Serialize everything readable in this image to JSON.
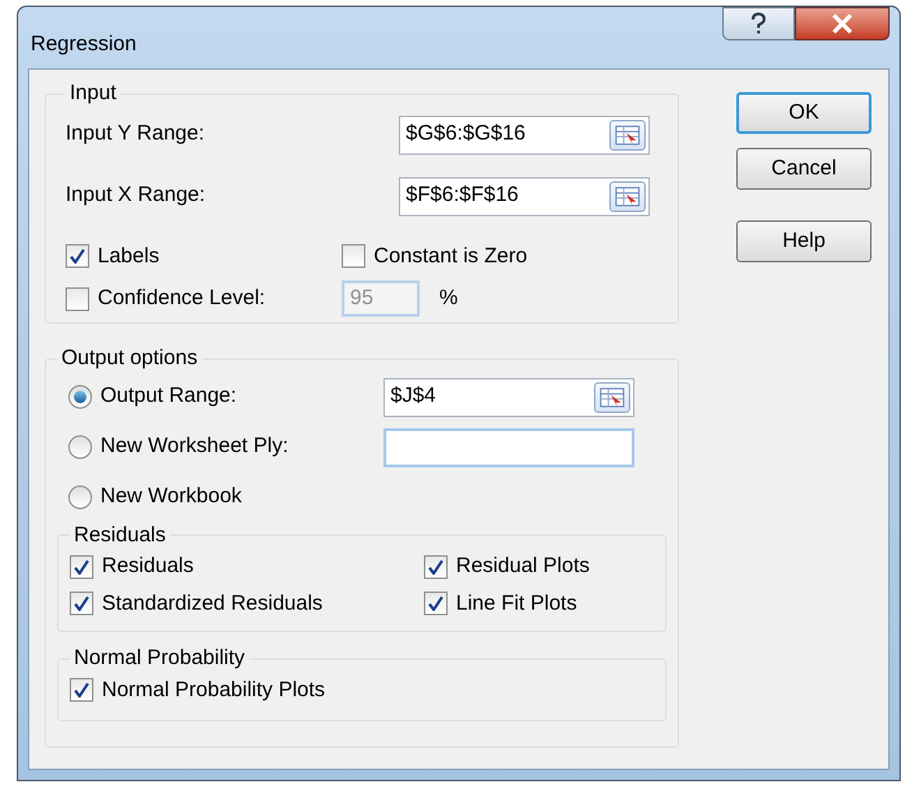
{
  "window": {
    "title": "Regression"
  },
  "input": {
    "title": "Input",
    "fields": [
      {
        "label": "Input Y Range:",
        "value": "$G$6:$G$16"
      },
      {
        "label": "Input X Range:",
        "value": "$F$6:$F$16"
      }
    ],
    "options": [
      {
        "label": "Labels",
        "checked": true
      },
      {
        "label": "Constant is Zero",
        "checked": false
      },
      {
        "label": "Confidence Level:",
        "checked": false
      }
    ],
    "confidence": {
      "value": "95",
      "unit": "%",
      "disabled": true
    }
  },
  "output": {
    "title": "Output options",
    "choices": [
      {
        "label": "Output Range:",
        "selected": true,
        "kind": "range",
        "value": "$J$4"
      },
      {
        "label": "New Worksheet Ply:",
        "selected": false,
        "kind": "text",
        "focused": true
      },
      {
        "label": "New Workbook",
        "selected": false,
        "kind": "plain"
      }
    ],
    "residuals": {
      "title": "Residuals",
      "options": [
        {
          "label": "Residuals",
          "checked": true
        },
        {
          "label": "Residual Plots",
          "checked": true
        },
        {
          "label": "Standardized Residuals",
          "checked": true
        },
        {
          "label": "Line Fit Plots",
          "checked": true
        }
      ]
    },
    "normal_probability": {
      "title": "Normal Probability",
      "options": [
        {
          "label": "Normal Probability Plots",
          "checked": true
        }
      ]
    }
  },
  "buttons": [
    {
      "label": "OK",
      "default": true
    },
    {
      "label": "Cancel",
      "default": false
    },
    {
      "label": "Help",
      "default": false
    }
  ]
}
